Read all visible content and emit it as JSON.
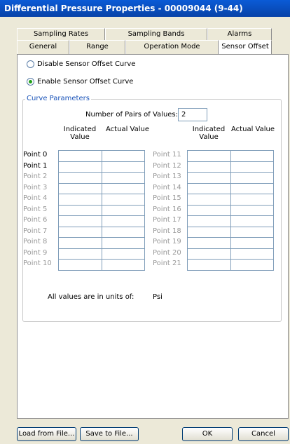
{
  "window": {
    "title": "Differential Pressure Properties - 00009044 (9-44)"
  },
  "tabs_back": [
    "Sampling Rates",
    "Sampling Bands",
    "Alarms"
  ],
  "tabs_front": [
    "General",
    "Range",
    "Operation Mode",
    "Sensor Offset"
  ],
  "active_tab": "Sensor Offset",
  "options": {
    "disable_label": "Disable Sensor Offset Curve",
    "enable_label": "Enable Sensor Offset Curve",
    "selected": "enable"
  },
  "curve": {
    "group_title": "Curve Parameters",
    "pairs_label": "Number of Pairs of Values:",
    "pairs_value": "2",
    "col_indicated": "Indicated Value",
    "col_actual": "Actual Value",
    "points_left": [
      "Point 0",
      "Point 1",
      "Point 2",
      "Point 3",
      "Point 4",
      "Point 5",
      "Point 6",
      "Point 7",
      "Point 8",
      "Point 9",
      "Point 10"
    ],
    "points_right": [
      "Point 11",
      "Point 12",
      "Point 13",
      "Point 14",
      "Point 15",
      "Point 16",
      "Point 17",
      "Point 18",
      "Point 19",
      "Point 20",
      "Point 21"
    ],
    "enabled_points": 2,
    "units_label": "All values are in units of:",
    "units_value": "Psi"
  },
  "buttons": {
    "load": "Load from File...",
    "save": "Save to File...",
    "ok": "OK",
    "cancel": "Cancel"
  }
}
